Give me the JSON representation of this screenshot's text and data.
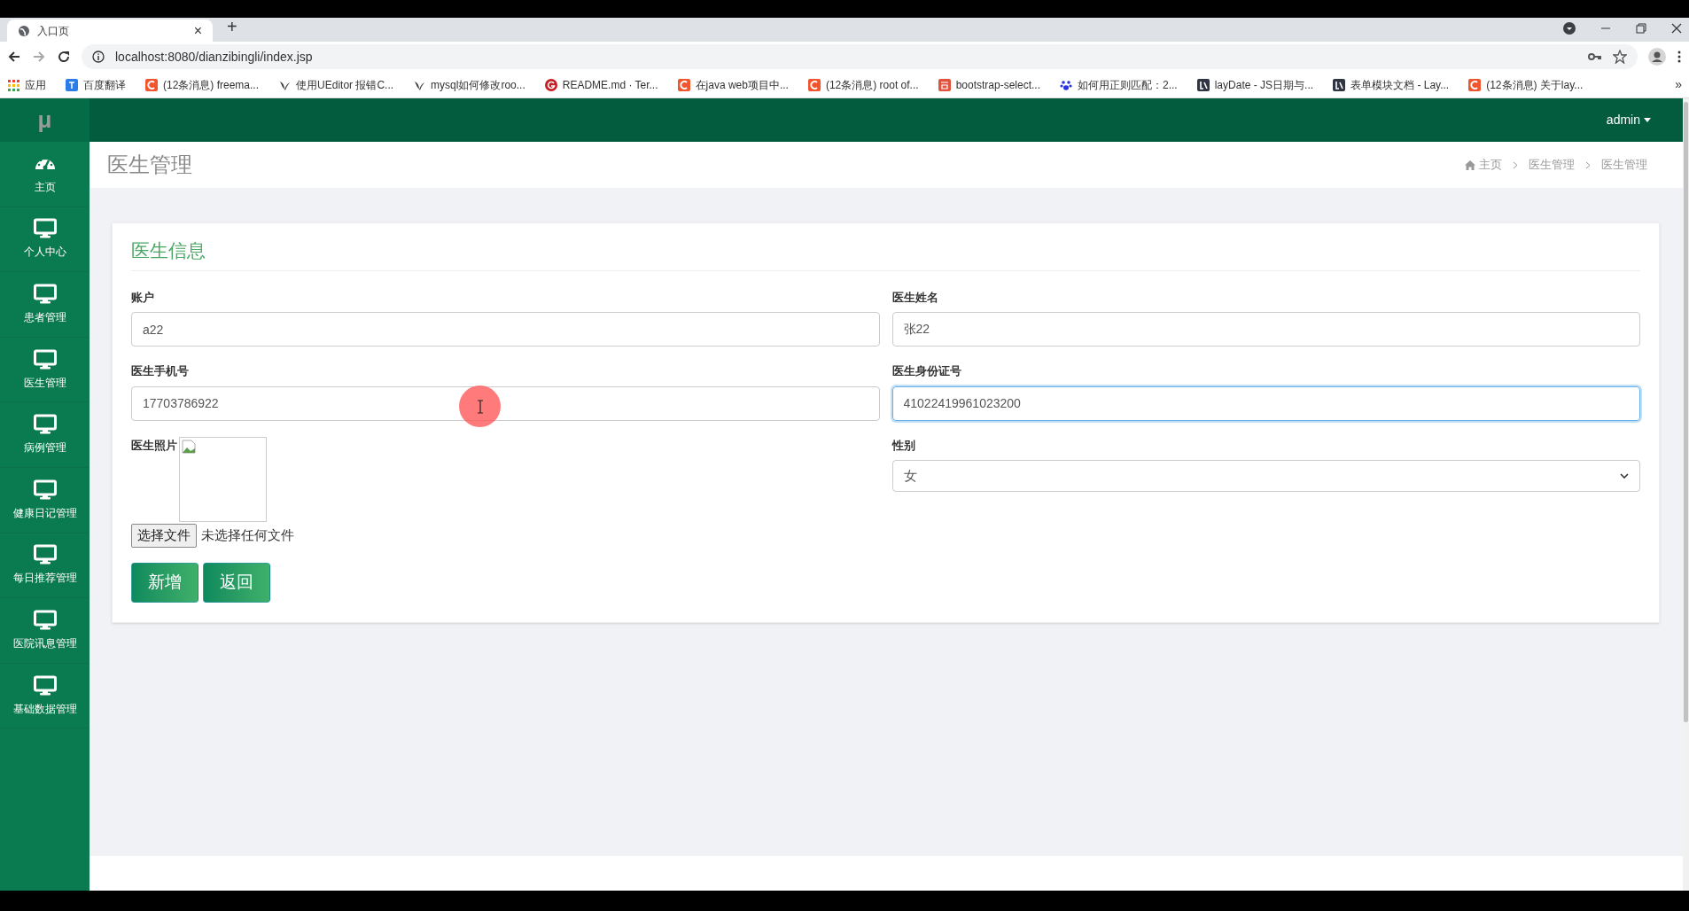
{
  "browser": {
    "tab": {
      "title": "入口页",
      "close": "×"
    },
    "new_tab": "+",
    "address": "localhost:8080/dianzibingli/index.jsp",
    "bookmarks": [
      {
        "label": "应用",
        "kind": "apps"
      },
      {
        "label": "百度翻译",
        "kind": "blue"
      },
      {
        "label": "(12条消息) freema...",
        "kind": "c"
      },
      {
        "label": "使用UEditor 报错C...",
        "kind": "bird"
      },
      {
        "label": "mysql如何修改roo...",
        "kind": "bird"
      },
      {
        "label": "README.md · Ter...",
        "kind": "g"
      },
      {
        "label": "在java web项目中...",
        "kind": "c"
      },
      {
        "label": "(12条消息) root of...",
        "kind": "c"
      },
      {
        "label": "bootstrap-select...",
        "kind": "jian"
      },
      {
        "label": "如何用正则匹配：2...",
        "kind": "paw"
      },
      {
        "label": "layDate - JS日期与...",
        "kind": "lay"
      },
      {
        "label": "表单模块文档 - Lay...",
        "kind": "lay"
      },
      {
        "label": "(12条消息) 关于lay...",
        "kind": "c"
      }
    ],
    "more": "»"
  },
  "app": {
    "logo": "μ",
    "user": "admin"
  },
  "sidebar": {
    "items": [
      {
        "label": "主页",
        "kind": "dashboard"
      },
      {
        "label": "个人中心",
        "kind": "monitor"
      },
      {
        "label": "患者管理",
        "kind": "monitor"
      },
      {
        "label": "医生管理",
        "kind": "monitor"
      },
      {
        "label": "病例管理",
        "kind": "monitor"
      },
      {
        "label": "健康日记管理",
        "kind": "monitor"
      },
      {
        "label": "每日推荐管理",
        "kind": "monitor"
      },
      {
        "label": "医院讯息管理",
        "kind": "monitor"
      },
      {
        "label": "基础数据管理",
        "kind": "monitor"
      }
    ]
  },
  "page_title": "医生管理",
  "breadcrumbs": [
    "主页",
    "医生管理",
    "医生管理"
  ],
  "form": {
    "title": "医生信息",
    "fields": [
      {
        "label": "账户",
        "value": "a22",
        "kind": "text",
        "focused": false
      },
      {
        "label": "医生姓名",
        "value": "张22",
        "kind": "text",
        "focused": false
      },
      {
        "label": "医生手机号",
        "value": "17703786922",
        "kind": "text",
        "focused": false
      },
      {
        "label": "医生身份证号",
        "value": "41022419961023200",
        "kind": "text",
        "focused": true
      },
      {
        "label": "医生照片",
        "kind": "photo",
        "button": "选择文件",
        "status": "未选择任何文件"
      },
      {
        "label": "性别",
        "value": "女",
        "kind": "select"
      }
    ],
    "buttons": [
      "新增",
      "返回"
    ]
  }
}
